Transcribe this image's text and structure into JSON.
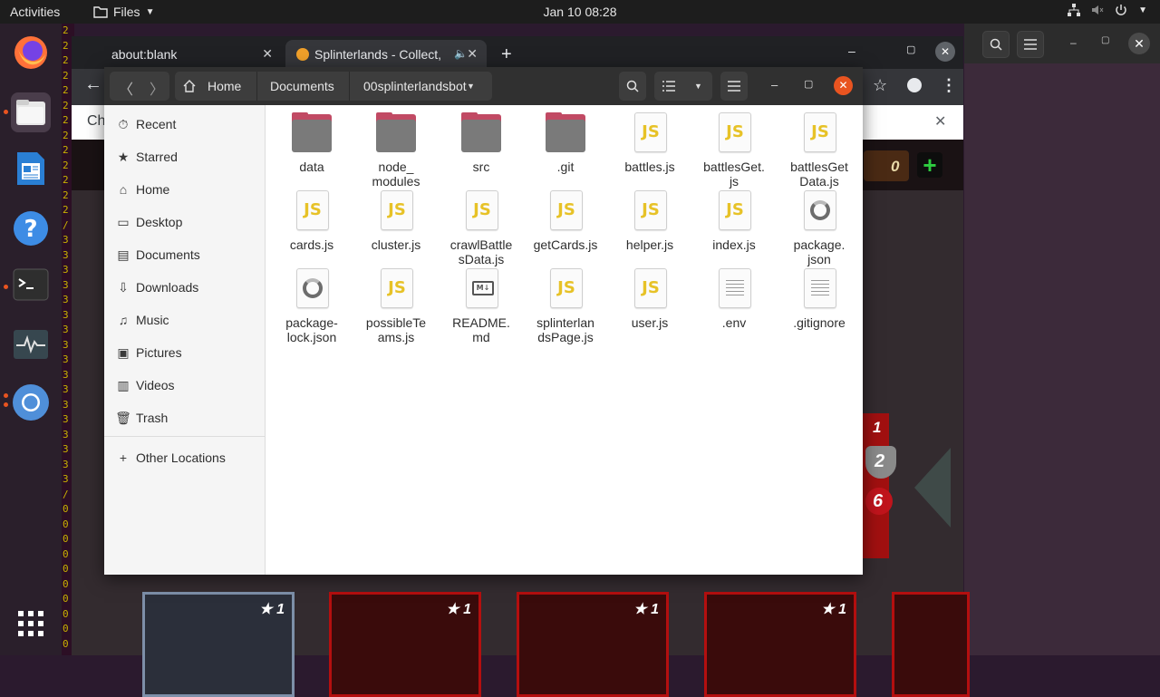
{
  "topbar": {
    "activities": "Activities",
    "app_menu": "Files",
    "clock": "Jan 10  08:28"
  },
  "terminal_strip": [
    "2",
    "2",
    "2",
    "2",
    "2",
    "2",
    "2",
    "2",
    "2",
    "2",
    "2",
    "2",
    "2",
    "/",
    "3",
    "3",
    "3",
    "3",
    "3",
    "3",
    "3",
    "3",
    "3",
    "3",
    "3",
    "3",
    "3",
    "3",
    "3",
    "3",
    "3",
    "/",
    "0",
    "0",
    "0",
    "0",
    "0",
    "0",
    "0",
    "0",
    "0",
    "0"
  ],
  "chrome": {
    "tabs": [
      {
        "label": "about:blank"
      },
      {
        "label": "Splinterlands - Collect,"
      }
    ],
    "bookmark_text": "Ch",
    "game_counter": "0",
    "game_stats": [
      "1",
      "2",
      "6"
    ],
    "card_levels": [
      "1",
      "1",
      "1",
      "1"
    ]
  },
  "files": {
    "breadcrumbs": [
      {
        "label": "Home"
      },
      {
        "label": "Documents"
      },
      {
        "label": "00splinterlandsbot"
      }
    ],
    "sidebar": [
      {
        "label": "Recent",
        "icon": "clock-icon"
      },
      {
        "label": "Starred",
        "icon": "star-icon"
      },
      {
        "label": "Home",
        "icon": "home-icon"
      },
      {
        "label": "Desktop",
        "icon": "desktop-icon"
      },
      {
        "label": "Documents",
        "icon": "document-icon"
      },
      {
        "label": "Downloads",
        "icon": "download-icon"
      },
      {
        "label": "Music",
        "icon": "music-icon"
      },
      {
        "label": "Pictures",
        "icon": "picture-icon"
      },
      {
        "label": "Videos",
        "icon": "video-icon"
      },
      {
        "label": "Trash",
        "icon": "trash-icon"
      },
      {
        "label": "Other Locations",
        "icon": "plus-icon"
      }
    ],
    "items": [
      {
        "name": "data",
        "type": "folder"
      },
      {
        "name": "node_\nmodules",
        "type": "folder"
      },
      {
        "name": "src",
        "type": "folder"
      },
      {
        "name": ".git",
        "type": "folder"
      },
      {
        "name": "battles.js",
        "type": "js"
      },
      {
        "name": "battlesGet.\njs",
        "type": "js"
      },
      {
        "name": "battlesGet\nData.js",
        "type": "js"
      },
      {
        "name": "cards.js",
        "type": "js"
      },
      {
        "name": "cluster.js",
        "type": "js"
      },
      {
        "name": "crawlBattle\nsData.js",
        "type": "js"
      },
      {
        "name": "getCards.js",
        "type": "js"
      },
      {
        "name": "helper.js",
        "type": "js"
      },
      {
        "name": "index.js",
        "type": "js"
      },
      {
        "name": "package.\njson",
        "type": "json"
      },
      {
        "name": "package-\nlock.json",
        "type": "json"
      },
      {
        "name": "possibleTe\nams.js",
        "type": "js"
      },
      {
        "name": "README.\nmd",
        "type": "md"
      },
      {
        "name": "splinterlan\ndsPage.js",
        "type": "js"
      },
      {
        "name": "user.js",
        "type": "js"
      },
      {
        "name": ".env",
        "type": "text"
      },
      {
        "name": ".gitignore",
        "type": "text"
      }
    ]
  },
  "colors": {
    "accent_close": "#e95420",
    "folder_tab": "#c14a64",
    "js_label": "#e7c227"
  }
}
